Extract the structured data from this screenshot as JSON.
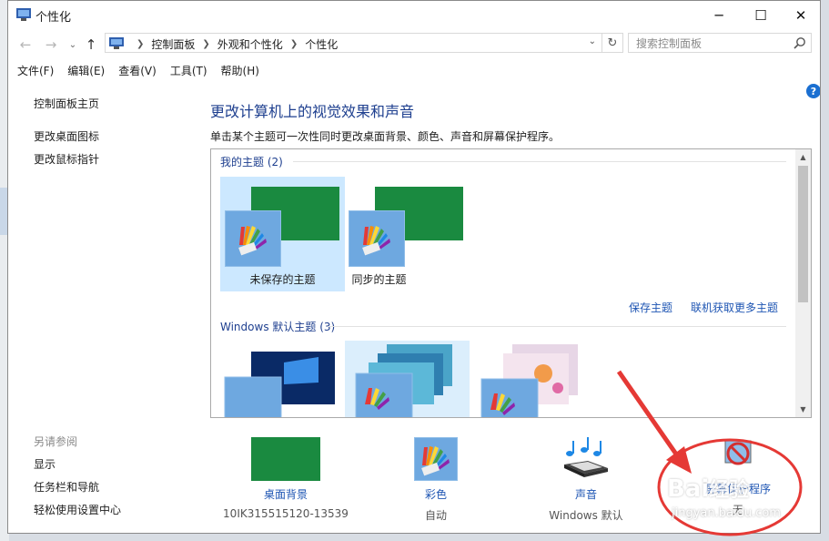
{
  "window": {
    "title": "个性化"
  },
  "address": {
    "crumbs": [
      "控制面板",
      "外观和个性化",
      "个性化"
    ],
    "search_placeholder": "搜索控制面板"
  },
  "menu": [
    "文件(F)",
    "编辑(E)",
    "查看(V)",
    "工具(T)",
    "帮助(H)"
  ],
  "sidebar": {
    "links": [
      "控制面板主页",
      "更改桌面图标",
      "更改鼠标指针"
    ],
    "see_also_title": "另请参阅",
    "see_also": [
      "显示",
      "任务栏和导航",
      "轻松使用设置中心"
    ]
  },
  "main": {
    "title": "更改计算机上的视觉效果和声音",
    "description": "单击某个主题可一次性同时更改桌面背景、颜色、声音和屏幕保护程序。",
    "my_themes_header": "我的主题 (2)",
    "my_themes": [
      "未保存的主题",
      "同步的主题"
    ],
    "save_theme": "保存主题",
    "get_more": "联机获取更多主题",
    "windows_themes_header": "Windows 默认主题 (3)"
  },
  "bottom": {
    "desktop": {
      "name": "桌面背景",
      "value": "10IK315515120-13539"
    },
    "color": {
      "name": "彩色",
      "value": "自动"
    },
    "sound": {
      "name": "声音",
      "value": "Windows 默认"
    },
    "screensaver": {
      "name": "屏幕保护程序",
      "value": "无"
    }
  },
  "watermark": {
    "logo": "Baidu经验",
    "url": "jingyan.baidu.com"
  },
  "colors": {
    "accent": "#1e3f8f",
    "link": "#1e55b3",
    "theme_green": "#1a8a40",
    "selection": "#cce8ff",
    "annotation": "#e53935"
  }
}
